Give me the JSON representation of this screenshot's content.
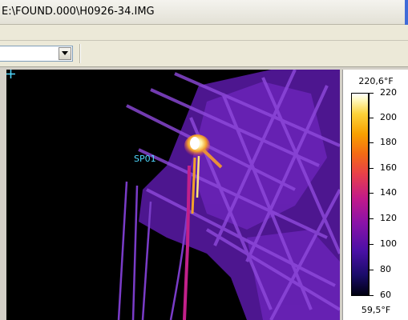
{
  "window": {
    "title": "E:\\FOUND.000\\H0926-34.IMG"
  },
  "toolbar": {
    "combo_value": ""
  },
  "thermal": {
    "spot": {
      "label": "SP01"
    }
  },
  "scale": {
    "max_label": "220,6°F",
    "min_label": "59,5°F",
    "ticks": [
      "220",
      "200",
      "180",
      "160",
      "140",
      "120",
      "100",
      "80",
      "60"
    ],
    "palette": "iron"
  },
  "colors": {
    "spot_label": "#4fd9ff",
    "title_bar_edge": "#3f6bd8"
  }
}
